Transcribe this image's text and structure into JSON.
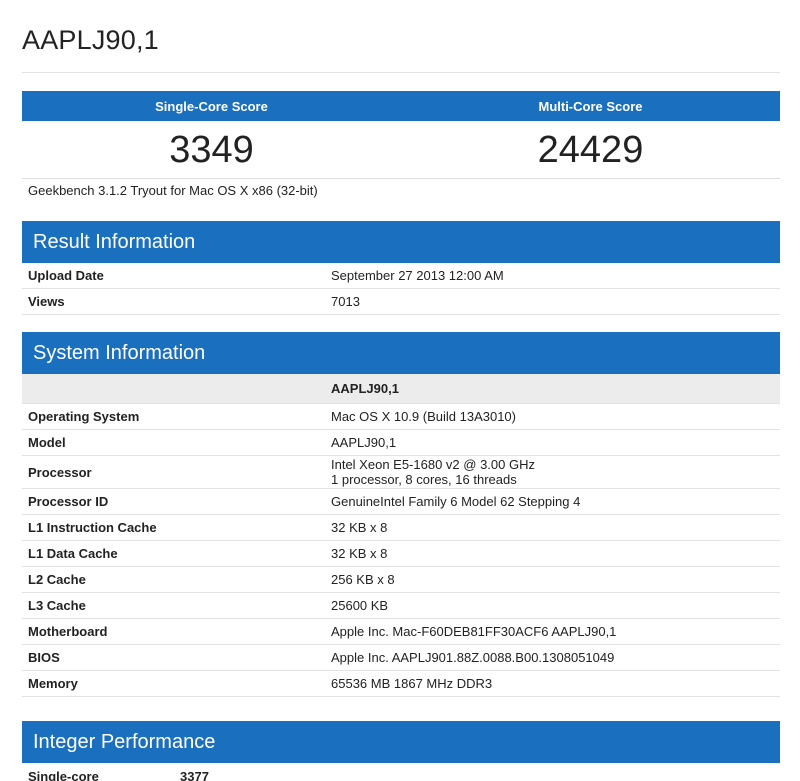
{
  "title": "AAPLJ90,1",
  "scores": {
    "single_label": "Single-Core Score",
    "multi_label": "Multi-Core Score",
    "single_value": "3349",
    "multi_value": "24429"
  },
  "version": "Geekbench 3.1.2 Tryout for Mac OS X x86 (32-bit)",
  "result_info": {
    "heading": "Result Information",
    "rows": [
      {
        "label": "Upload Date",
        "value": "September 27 2013 12:00 AM"
      },
      {
        "label": "Views",
        "value": "7013"
      }
    ]
  },
  "system_info": {
    "heading": "System Information",
    "column_header": "AAPLJ90,1",
    "rows": [
      {
        "label": "Operating System",
        "value": "Mac OS X 10.9 (Build 13A3010)"
      },
      {
        "label": "Model",
        "value": "AAPLJ90,1"
      },
      {
        "label": "Processor",
        "value": "Intel Xeon E5-1680 v2 @ 3.00 GHz",
        "value2": "1 processor, 8 cores, 16 threads"
      },
      {
        "label": "Processor ID",
        "value": "GenuineIntel Family 6 Model 62 Stepping 4"
      },
      {
        "label": "L1 Instruction Cache",
        "value": "32 KB x 8"
      },
      {
        "label": "L1 Data Cache",
        "value": "32 KB x 8"
      },
      {
        "label": "L2 Cache",
        "value": "256 KB x 8"
      },
      {
        "label": "L3 Cache",
        "value": "25600 KB"
      },
      {
        "label": "Motherboard",
        "value": "Apple Inc. Mac-F60DEB81FF30ACF6 AAPLJ90,1"
      },
      {
        "label": "BIOS",
        "value": "Apple Inc. AAPLJ901.88Z.0088.B00.1308051049"
      },
      {
        "label": "Memory",
        "value": "65536 MB 1867 MHz DDR3"
      }
    ]
  },
  "integer_perf": {
    "heading": "Integer Performance",
    "row_label": "Single-core",
    "row_value": "3377"
  }
}
